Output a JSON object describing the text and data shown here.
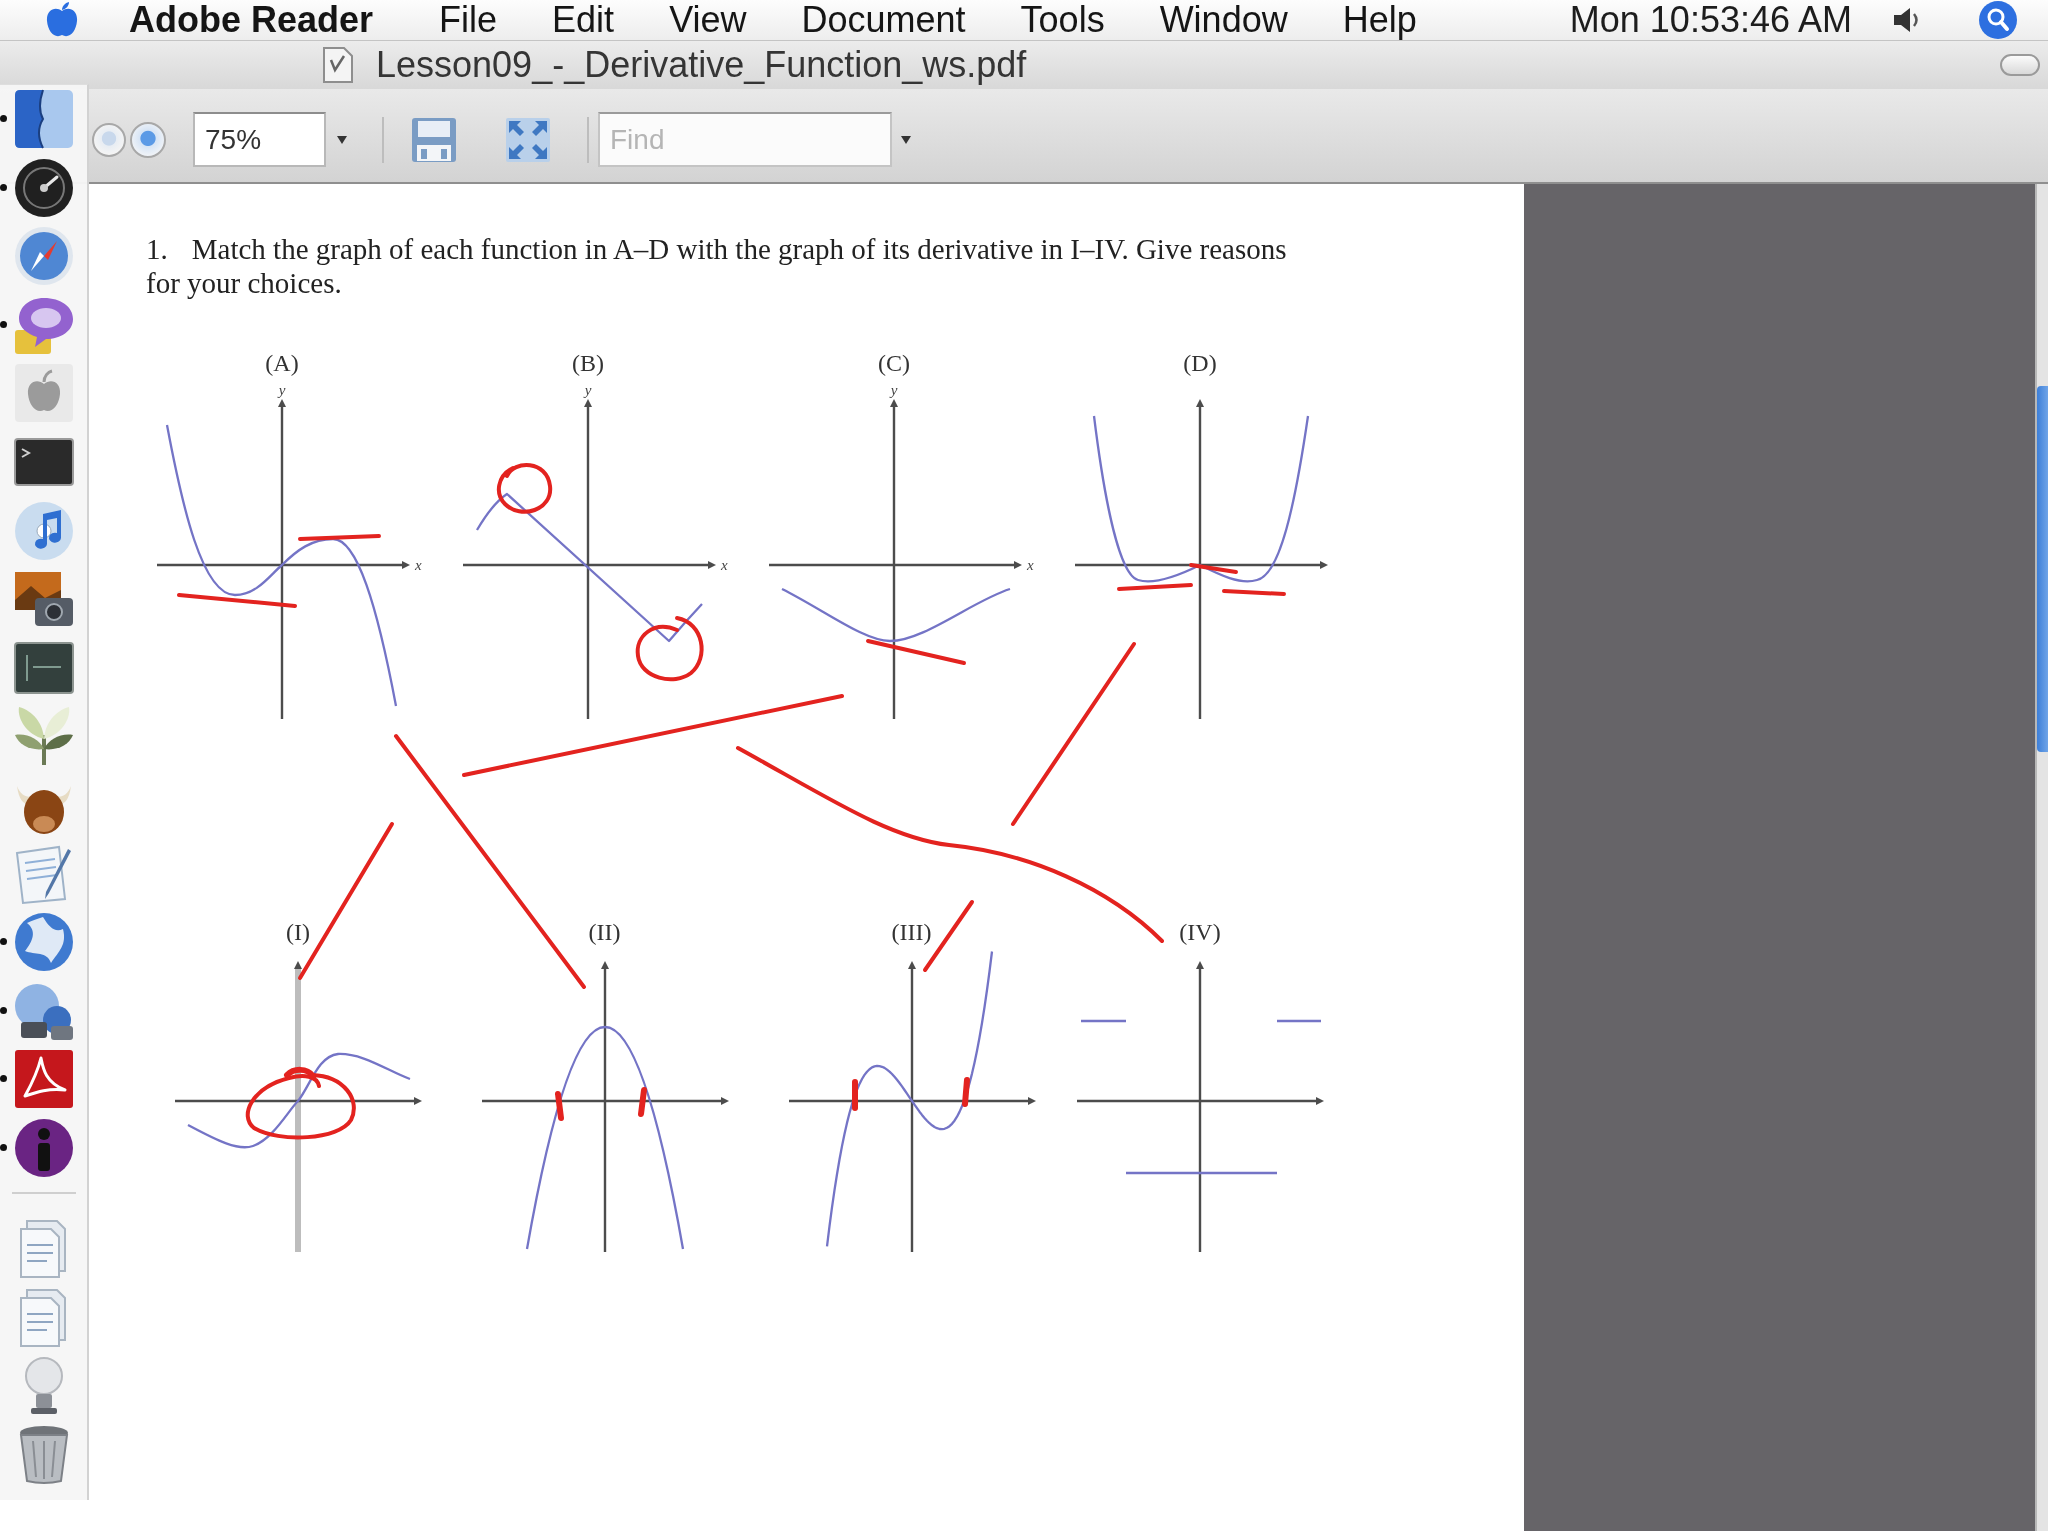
{
  "menu_bar": {
    "app_name": "Adobe Reader",
    "menus": [
      "File",
      "Edit",
      "View",
      "Document",
      "Tools",
      "Window",
      "Help"
    ],
    "clock": "Mon 10:53:46 AM"
  },
  "window": {
    "title": "Lesson09_-_Derivative_Function_ws.pdf"
  },
  "toolbar": {
    "zoom": "75%",
    "find": {
      "placeholder": "Find"
    }
  },
  "document": {
    "question": {
      "number": "1.",
      "text": "Match the graph of each function in A–D with the graph of its derivative in I–IV. Give reasons for your choices."
    },
    "functions": [
      {
        "label": "(A)",
        "y_axis": "y",
        "x_axis": "x"
      },
      {
        "label": "(B)",
        "y_axis": "y",
        "x_axis": "x"
      },
      {
        "label": "(C)",
        "y_axis": "y",
        "x_axis": "x"
      },
      {
        "label": "(D)"
      }
    ],
    "derivatives": [
      {
        "label": "(I)"
      },
      {
        "label": "(II)"
      },
      {
        "label": "(III)"
      },
      {
        "label": "(IV)"
      }
    ]
  },
  "dock": {
    "items": [
      {
        "running": true
      },
      {
        "running": true
      },
      {
        "running": false
      },
      {
        "running": true
      },
      {
        "running": false
      },
      {
        "running": false
      },
      {
        "running": false
      },
      {
        "running": false
      },
      {
        "running": false
      },
      {
        "running": false
      },
      {
        "running": false
      },
      {
        "running": false
      },
      {
        "running": true
      },
      {
        "running": true
      },
      {
        "running": true
      },
      {
        "running": true
      },
      {
        "running": false
      },
      {
        "running": false
      },
      {
        "running": false
      },
      {
        "running": false
      }
    ]
  }
}
